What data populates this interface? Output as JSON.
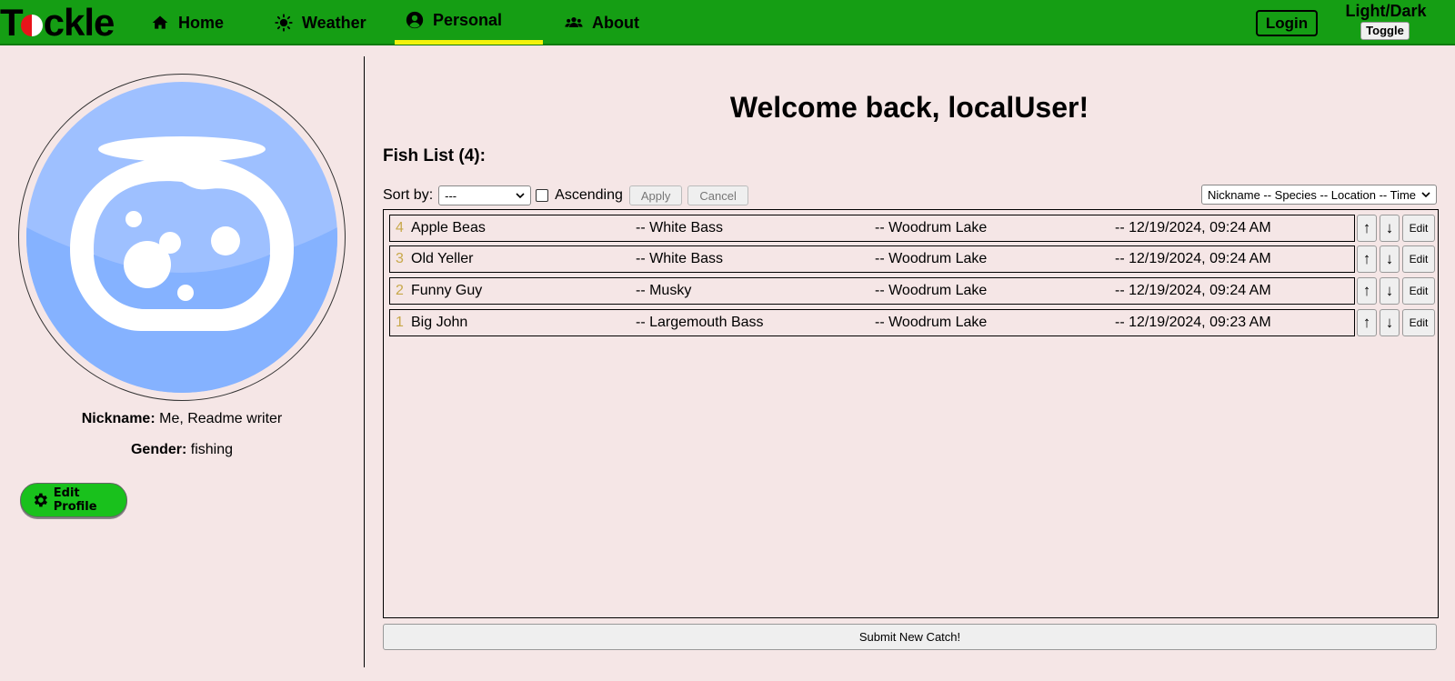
{
  "app": {
    "logo_text_left": "T",
    "logo_text_right": "ckle"
  },
  "nav": {
    "items": [
      {
        "label": "Home",
        "icon": "home-icon"
      },
      {
        "label": "Weather",
        "icon": "sun-icon"
      },
      {
        "label": "Personal",
        "icon": "user-circle-icon",
        "active": true
      },
      {
        "label": "About",
        "icon": "users-icon"
      }
    ],
    "login_label": "Login",
    "theme_label": "Light/Dark",
    "theme_toggle_label": "Toggle"
  },
  "profile": {
    "avatar_icon": "fishbowl-icon",
    "nickname_key": "Nickname:",
    "nickname_value": "Me, Readme writer",
    "gender_key": "Gender:",
    "gender_value": "fishing",
    "edit_label": "Edit Profile"
  },
  "main": {
    "welcome": "Welcome back, localUser!",
    "fish_list_heading": "Fish List (4):",
    "sort_label": "Sort by:",
    "sort_value": "---",
    "ascending_label": "Ascending",
    "ascending_checked": false,
    "apply_label": "Apply",
    "cancel_label": "Cancel",
    "display_format": "Nickname -- Species -- Location -- Time",
    "rows": [
      {
        "index": "4",
        "nickname": "Apple Beas",
        "species": "-- White Bass",
        "location": "-- Woodrum Lake",
        "time": "-- 12/19/2024, 09:24 AM"
      },
      {
        "index": "3",
        "nickname": "Old Yeller",
        "species": "-- White Bass",
        "location": "-- Woodrum Lake",
        "time": "-- 12/19/2024, 09:24 AM"
      },
      {
        "index": "2",
        "nickname": "Funny Guy",
        "species": "-- Musky",
        "location": "-- Woodrum Lake",
        "time": "-- 12/19/2024, 09:24 AM"
      },
      {
        "index": "1",
        "nickname": "Big John",
        "species": "-- Largemouth Bass",
        "location": "-- Woodrum Lake",
        "time": "-- 12/19/2024, 09:23 AM"
      }
    ],
    "row_up_label": "↑",
    "row_down_label": "↓",
    "row_edit_label": "Edit",
    "submit_label": "Submit New Catch!"
  },
  "colors": {
    "nav_green": "#159e14",
    "active_underline": "#f2f20c",
    "page_bg": "#f5e6e6",
    "edit_green": "#19c11c",
    "avatar_blue": "#85b2ff"
  }
}
